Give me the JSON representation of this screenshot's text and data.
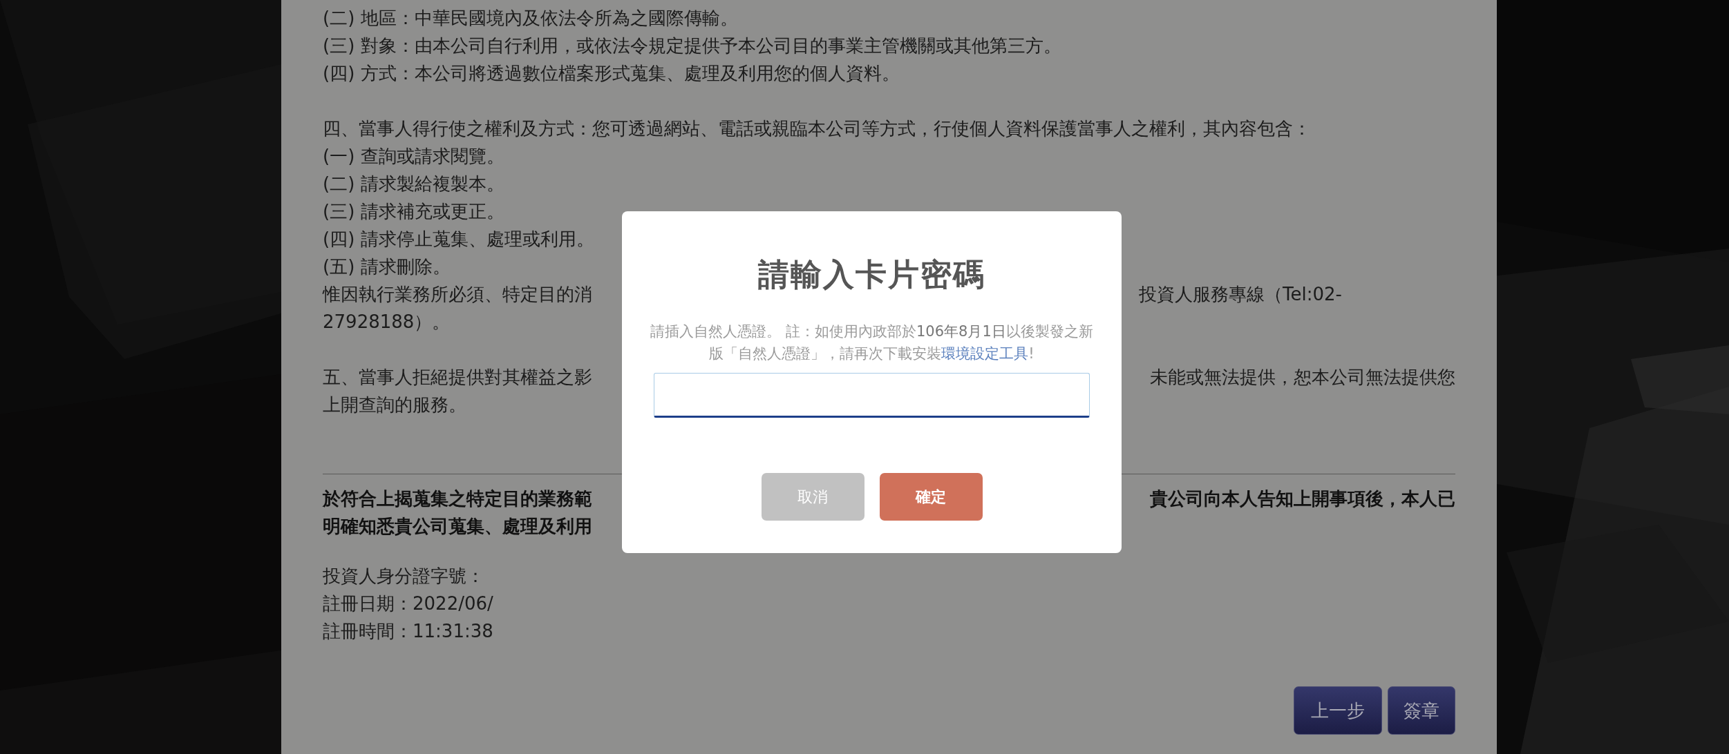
{
  "document": {
    "paragraphs": [
      {
        "lines": [
          {
            "kind": "full",
            "text": "(二) 地區：中華民國境內及依法令所為之國際傳輸。"
          },
          {
            "kind": "full",
            "text": "(三) 對象：由本公司自行利用，或依法令規定提供予本公司目的事業主管機關或其他第三方。"
          },
          {
            "kind": "full",
            "text": "(四) 方式：本公司將透過數位檔案形式蒐集、處理及利用您的個人資料。"
          }
        ]
      },
      {
        "lines": [
          {
            "kind": "full",
            "text": "四、當事人得行使之權利及方式：您可透過網站、電話或親臨本公司等方式，行使個人資料保護當事人之權利，其內容包含："
          },
          {
            "kind": "full",
            "text": "(一) 查詢或請求閱覽。"
          },
          {
            "kind": "full",
            "text": "(二) 請求製給複製本。"
          },
          {
            "kind": "full",
            "text": "(三) 請求補充或更正。"
          },
          {
            "kind": "full",
            "text": "(四) 請求停止蒐集、處理或利用。"
          },
          {
            "kind": "full",
            "text": "(五) 請求刪除。"
          },
          {
            "kind": "split",
            "left": "惟因執行業務所必須、特定目的消",
            "right": "投資人服務專線（Tel:02-"
          },
          {
            "kind": "full",
            "text": "27928188）。"
          }
        ]
      },
      {
        "lines": [
          {
            "kind": "split",
            "left": "五、當事人拒絕提供對其權益之影",
            "right": "未能或無法提供，恕本公司無法提供您"
          },
          {
            "kind": "full",
            "text": "上開查詢的服務。"
          }
        ]
      }
    ],
    "statement": {
      "lines": [
        {
          "kind": "split",
          "left": "於符合上揭蒐集之特定目的業務範",
          "right": "貴公司向本人告知上開事項後，本人已"
        },
        {
          "kind": "split",
          "left": "明確知悉貴公司蒐集、處理及利用"
        }
      ]
    },
    "registration": [
      "投資人身分證字號：",
      "註冊日期：2022/06/",
      "註冊時間：11:31:38"
    ],
    "buttons": [
      "上一步",
      "簽章"
    ]
  },
  "dialog": {
    "title": "請輸入卡片密碼",
    "note": {
      "text": "請插入自然人憑證。 註：如使用內政部於**106年8月1日**以後製發之新版「自然人憑證」，請再次下載安裝",
      "link": "環境設定工具",
      "after": "!"
    },
    "buttons": [
      {
        "kind": "cancel",
        "label": "取消"
      },
      {
        "kind": "confirm",
        "label": "確定"
      }
    ]
  }
}
